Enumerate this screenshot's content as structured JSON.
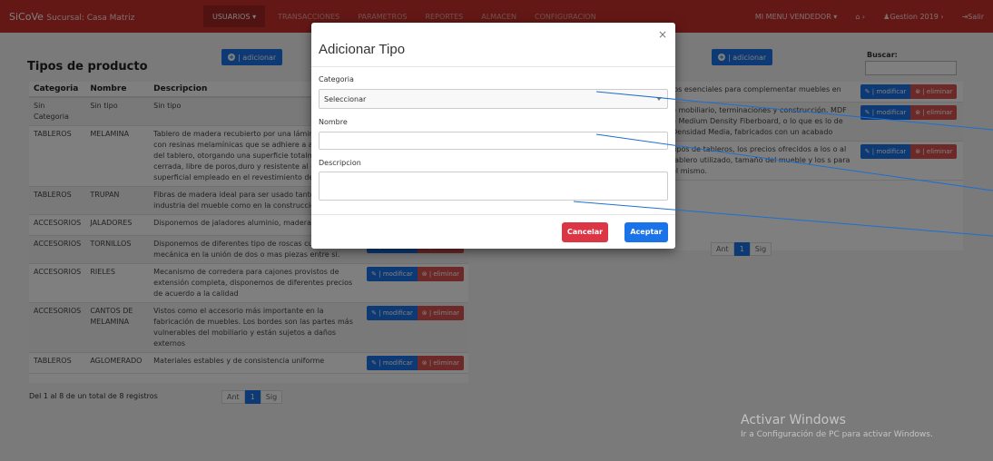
{
  "navbar": {
    "brand": "SiCoVe",
    "branch": "Sucursal: Casa Matriz",
    "items": [
      {
        "label": "USUARIOS ▾"
      },
      {
        "label": "TRANSACCIONES"
      },
      {
        "label": "PARAMETROS"
      },
      {
        "label": "REPORTES"
      },
      {
        "label": "ALMACEN"
      },
      {
        "label": "CONFIGURACION"
      }
    ],
    "vendor_menu": "MI MENU VENDEDOR ▾",
    "home_icon": "home-icon",
    "gestion": "Gestion 2019",
    "exit": "Salir"
  },
  "page": {
    "title": "Tipos de producto",
    "add_label": "| adicionar",
    "search_label": "Buscar:",
    "headers": [
      "Categoria",
      "Nombre",
      "Descripcion"
    ],
    "modify_label": "| modificar",
    "delete_label": "| eliminar",
    "rows": [
      {
        "cat": "Sin Categoria",
        "name": "Sin tipo",
        "desc": "Sin tipo"
      },
      {
        "cat": "TABLEROS",
        "name": "MELAMINA",
        "desc": "Tablero de madera recubierto por una lámina saturada con resinas melamínicas que se adhiere a ambas caras del tablero, otorgando una superficie totalmente cerrada, libre de poros,duro y resistente al desgaste superficial empleado en el revestimiento de muebles"
      },
      {
        "cat": "TABLEROS",
        "name": "TRUPAN",
        "desc": "Fibras de madera ideal para ser usado tanto en la industria del mueble como en la construcción"
      },
      {
        "cat": "ACCESORIOS",
        "name": "JALADORES",
        "desc": "Disponemos de jaladores aluminio, madera y plasticos"
      },
      {
        "cat": "ACCESORIOS",
        "name": "TORNILLOS",
        "desc": "Disponemos de diferentes tipo de roscas cuya función mecánica en la unión de dos o mas piezas entre si."
      },
      {
        "cat": "ACCESORIOS",
        "name": "RIELES",
        "desc": "Mecanismo de corredera para cajones provistos de extensión completa, disponemos de diferentes precios de acuerdo a la calidad"
      },
      {
        "cat": "ACCESORIOS",
        "name": "CANTOS DE MELAMINA",
        "desc": "Vistos como el accesorio más importante en la fabricación de muebles. Los bordes son las partes más vulnerables del mobiliario y están sujetos a daños externos"
      },
      {
        "cat": "TABLEROS",
        "name": "AGLOMERADO",
        "desc": "Materiales estables y de consistencia uniforme"
      }
    ],
    "right_rows": [
      {
        "desc": "los esenciales para complementar muebles en"
      },
      {
        "desc": "o mobiliario, terminaciones y construcción. MDF e Medium Density Fiberboard, o lo que es lo de Densidad Media, fabricados con un acabado"
      },
      {
        "desc": "tipos de tableros, los precios ofrecidos a los o al tablero utilizado, tamaño del mueble y los s para el mismo."
      }
    ],
    "info": "Del 1 al 8 de un total de 8 registros",
    "pager": {
      "prev": "Ant",
      "current": "1",
      "next": "Sig"
    }
  },
  "modal": {
    "title": "Adicionar Tipo",
    "close": "×",
    "category_label": "Categoria",
    "category_value": "Seleccionar",
    "name_label": "Nombre",
    "name_value": "",
    "desc_label": "Descripcion",
    "desc_value": "",
    "cancel": "Cancelar",
    "accept": "Aceptar"
  },
  "watermark": {
    "line1": "Activar Windows",
    "line2": "Ir a Configuración de PC para activar Windows."
  },
  "colors": {
    "navbar": "#c9302c",
    "primary": "#1a73e8",
    "danger": "#d9534f"
  }
}
